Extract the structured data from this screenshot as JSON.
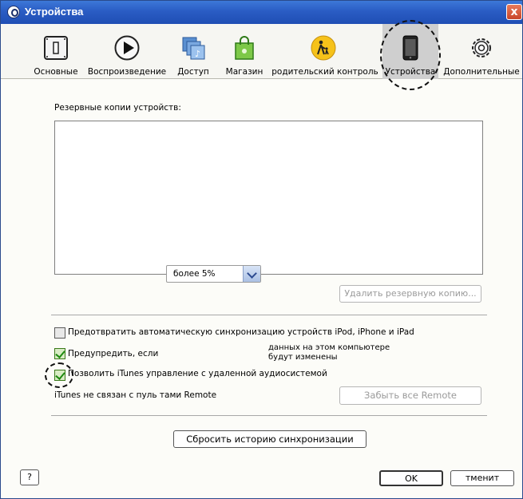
{
  "window": {
    "title": "Устройства",
    "close_label": "x"
  },
  "toolbar": {
    "items": [
      {
        "label": "Основные",
        "icon": "general-icon"
      },
      {
        "label": "Воспроизведение",
        "icon": "play-icon"
      },
      {
        "label": "Доступ",
        "icon": "sharing-icon"
      },
      {
        "label": "Магазин",
        "icon": "store-bag-icon"
      },
      {
        "label": "родительский контроль",
        "icon": "parental-icon"
      },
      {
        "label": "Устройства",
        "icon": "device-icon",
        "selected": true
      },
      {
        "label": "Дополнительные",
        "icon": "advanced-gear-icon"
      }
    ]
  },
  "backups": {
    "label": "Резервные копии устройств:",
    "items": [],
    "delete_button": "Удалить резервную копию..."
  },
  "options": {
    "prevent_sync": {
      "label": "Предотвратить автоматическую синхронизацию устройств iPod, iPhone и iPad",
      "checked": false
    },
    "warn": {
      "label": "Предупредить, если",
      "checked": true,
      "select_value": "более 5%",
      "suffix_line1": "данных на этом компьютере",
      "suffix_line2": "будут изменены"
    },
    "remote": {
      "label": "Позволить iTunes управление с удаленной аудиосистемой",
      "checked": true
    },
    "remote_status": "iTunes не связан с пуль тами Remote",
    "forget_remotes_button": "Забыть все Remote"
  },
  "reset_sync_button": "Сбросить историю синхронизации",
  "footer": {
    "help_label": "?",
    "ok_label": "OK",
    "cancel_label": "тменит"
  },
  "colors": {
    "title_bar": "#2a5cc4",
    "close": "#c8452a",
    "check": "#1e8a10"
  }
}
